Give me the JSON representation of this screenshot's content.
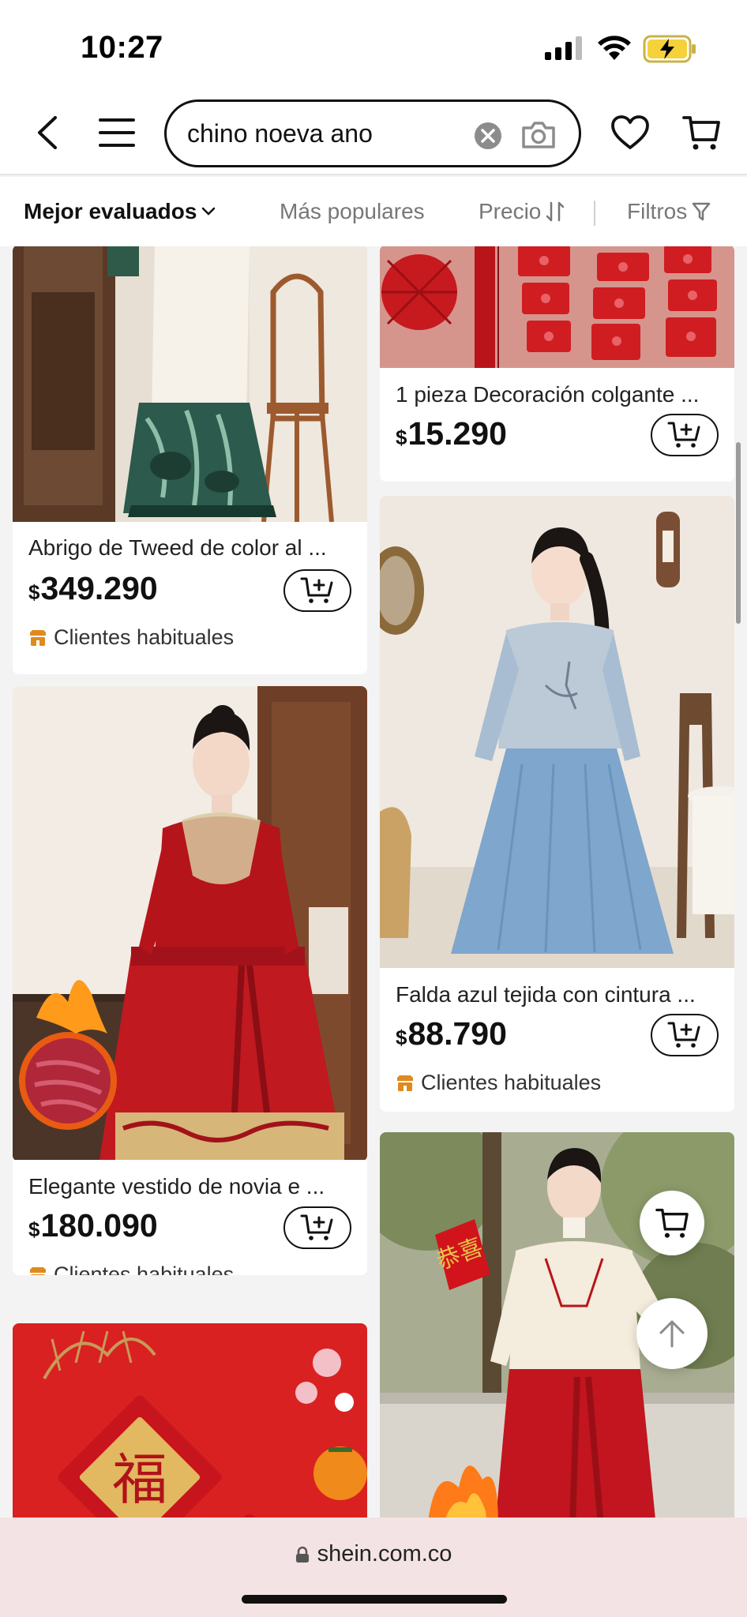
{
  "status_bar": {
    "time": "10:27"
  },
  "search": {
    "query": "chino noeva ano",
    "placeholder": ""
  },
  "sort_bar": {
    "top_rated": "Mejor evaluados",
    "popular": "Más populares",
    "price": "Precio",
    "filters": "Filtros"
  },
  "products": [
    {
      "title": "Abrigo de Tweed de color al ...",
      "currency": "$",
      "price": "349.290",
      "badge": "Clientes habituales"
    },
    {
      "title": "1 pieza Decoración colgante ...",
      "currency": "$",
      "price": "15.290",
      "badge": ""
    },
    {
      "title": "Elegante vestido de novia e  ...",
      "currency": "$",
      "price": "180.090",
      "badge": "Clientes habituales"
    },
    {
      "title": "Falda azul tejida con cintura ...",
      "currency": "$",
      "price": "88.790",
      "badge": "Clientes habituales"
    }
  ],
  "browser": {
    "url": "shein.com.co"
  },
  "icons": {
    "back": "chevron-left-icon",
    "menu": "hamburger-menu-icon",
    "clear": "clear-circle-icon",
    "camera": "camera-icon",
    "wishlist": "heart-icon",
    "cart": "cart-icon",
    "add_to_cart": "cart-plus-icon",
    "badge": "store-icon",
    "back_to_top": "arrow-up-icon",
    "lock": "lock-icon"
  },
  "colors": {
    "badge_orange": "#e08a1e",
    "browser_bar": "#f3e3e4",
    "battery_yellow": "#f6d23a"
  }
}
